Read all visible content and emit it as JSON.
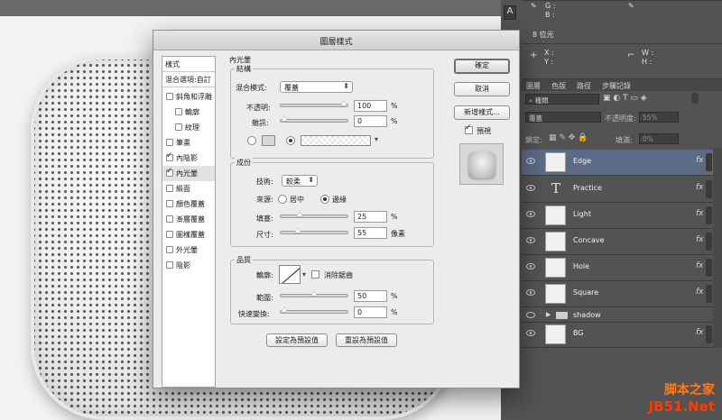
{
  "info_panel": {
    "g_label": "G :",
    "b_label": "B :",
    "bits": "8 位元",
    "x_label": "X :",
    "y_label": "Y :",
    "w_label": "W :",
    "h_label": "H :",
    "icon_a": "A"
  },
  "layers_panel": {
    "tabs": [
      "圖層",
      "色版",
      "路徑",
      "步驟記錄"
    ],
    "filter_label": "種類",
    "blend_mode": "覆蓋",
    "opacity_label": "不透明度:",
    "opacity_value": "55%",
    "lock_label": "鎖定:",
    "fill_label": "填滿:",
    "fill_value": "0%",
    "layers": [
      {
        "name": "Edge",
        "fx": "fx",
        "selected": true,
        "kind": "image"
      },
      {
        "name": "Practice",
        "fx": "fx",
        "selected": false,
        "kind": "text"
      },
      {
        "name": "Light",
        "fx": "fx",
        "selected": false,
        "kind": "image"
      },
      {
        "name": "Concave",
        "fx": "fx",
        "selected": false,
        "kind": "image"
      },
      {
        "name": "Hole",
        "fx": "fx",
        "selected": false,
        "kind": "image"
      },
      {
        "name": "Square",
        "fx": "fx",
        "selected": false,
        "kind": "image"
      },
      {
        "name": "shadow",
        "fx": "",
        "selected": false,
        "kind": "group"
      },
      {
        "name": "BG",
        "fx": "fx",
        "selected": false,
        "kind": "image"
      }
    ],
    "text_layer_glyph": "T"
  },
  "dialog": {
    "title": "圖層樣式",
    "styles_header": "樣式",
    "blend_options": "混合選項:自訂",
    "style_items": [
      {
        "label": "斜角和浮雕",
        "checked": false,
        "sub": false,
        "selected": false
      },
      {
        "label": "輪廓",
        "checked": false,
        "sub": true,
        "selected": false
      },
      {
        "label": "紋理",
        "checked": false,
        "sub": true,
        "selected": false
      },
      {
        "label": "筆畫",
        "checked": false,
        "sub": false,
        "selected": false
      },
      {
        "label": "內陰影",
        "checked": true,
        "sub": false,
        "selected": false
      },
      {
        "label": "內光暈",
        "checked": true,
        "sub": false,
        "selected": true
      },
      {
        "label": "緞面",
        "checked": false,
        "sub": false,
        "selected": false
      },
      {
        "label": "顏色覆蓋",
        "checked": false,
        "sub": false,
        "selected": false
      },
      {
        "label": "漸層覆蓋",
        "checked": false,
        "sub": false,
        "selected": false
      },
      {
        "label": "圖樣覆蓋",
        "checked": false,
        "sub": false,
        "selected": false
      },
      {
        "label": "外光暈",
        "checked": false,
        "sub": false,
        "selected": false
      },
      {
        "label": "陰影",
        "checked": false,
        "sub": false,
        "selected": false
      }
    ],
    "section_title": "內光暈",
    "structure": {
      "title": "結構",
      "blend_mode_label": "混合模式:",
      "blend_mode_value": "覆蓋",
      "opacity_label": "不透明:",
      "opacity_value": "100",
      "opacity_fraction": 1.0,
      "noise_label": "雜訊:",
      "noise_value": "0",
      "noise_fraction": 0.0,
      "percent": "%"
    },
    "elements": {
      "title": "成份",
      "technique_label": "技術:",
      "technique_value": "較柔",
      "source_label": "來源:",
      "source_center": "居中",
      "source_edge": "邊緣",
      "choke_label": "填塞:",
      "choke_value": "25",
      "choke_fraction": 0.25,
      "size_label": "尺寸:",
      "size_value": "55",
      "size_fraction": 0.22,
      "percent": "%",
      "px": "像素"
    },
    "quality": {
      "title": "品質",
      "contour_label": "輪廓:",
      "antialias_label": "消除鋸齒",
      "range_label": "範圍:",
      "range_value": "50",
      "range_fraction": 0.5,
      "jitter_label": "快速變換:",
      "jitter_value": "0",
      "jitter_fraction": 0.0,
      "percent": "%"
    },
    "make_default": "設定為預設值",
    "reset_default": "重設為預設值",
    "ok": "確定",
    "cancel": "取消",
    "new_style": "新增樣式...",
    "preview_label": "預視"
  },
  "watermark": {
    "line1": "脚本之家",
    "line2": "JB51.Net"
  },
  "colors": {
    "accent_selected_layer": "#5b6b86",
    "watermark_orange": "#ff7a1a",
    "watermark_red": "#ff3c00"
  }
}
